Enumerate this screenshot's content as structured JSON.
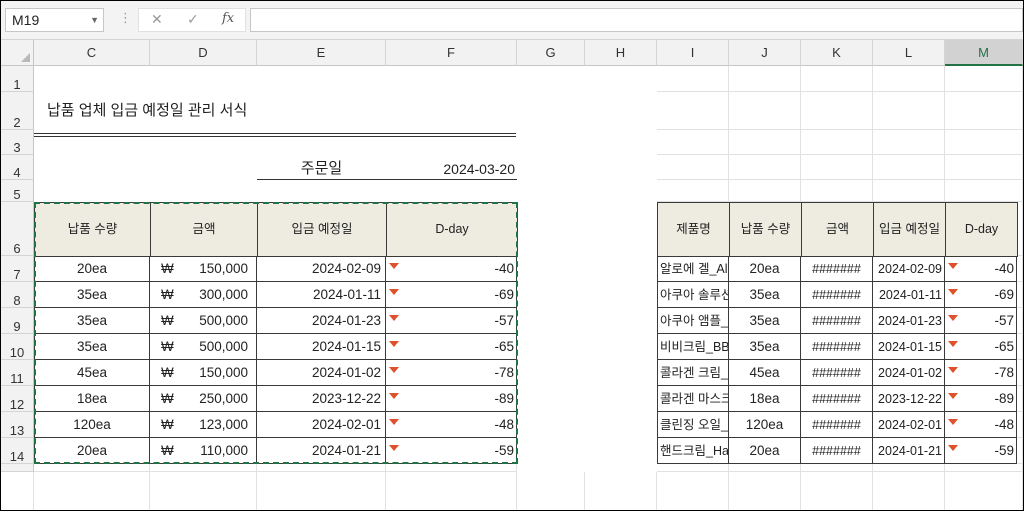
{
  "formula_bar": {
    "name_box": "M19",
    "cancel_icon": "✕",
    "enter_icon": "✓",
    "fx_label": "fx",
    "formula": ""
  },
  "columns": [
    "C",
    "D",
    "E",
    "F",
    "G",
    "H",
    "I",
    "J",
    "K",
    "L",
    "M"
  ],
  "rows": [
    "1",
    "2",
    "3",
    "4",
    "5",
    "6",
    "7",
    "8",
    "9",
    "10",
    "11",
    "12",
    "13",
    "14"
  ],
  "selected_column": "M",
  "sheet": {
    "title": "납품 업체 입금 예정일 관리 서식",
    "order_date_label": "주문일",
    "order_date_value": "2024-03-20"
  },
  "left_table": {
    "headers": [
      "납품 수량",
      "금액",
      "입금 예정일",
      "D-day"
    ],
    "currency_symbol": "₩",
    "rows": [
      {
        "qty": "20ea",
        "amount": "150,000",
        "date": "2024-02-09",
        "dday": "-40"
      },
      {
        "qty": "35ea",
        "amount": "300,000",
        "date": "2024-01-11",
        "dday": "-69"
      },
      {
        "qty": "35ea",
        "amount": "500,000",
        "date": "2024-01-23",
        "dday": "-57"
      },
      {
        "qty": "35ea",
        "amount": "500,000",
        "date": "2024-01-15",
        "dday": "-65"
      },
      {
        "qty": "45ea",
        "amount": "150,000",
        "date": "2024-01-02",
        "dday": "-78"
      },
      {
        "qty": "18ea",
        "amount": "250,000",
        "date": "2023-12-22",
        "dday": "-89"
      },
      {
        "qty": "120ea",
        "amount": "123,000",
        "date": "2024-02-01",
        "dday": "-48"
      },
      {
        "qty": "20ea",
        "amount": "110,000",
        "date": "2024-01-21",
        "dday": "-59"
      }
    ]
  },
  "right_table": {
    "headers": [
      "제품명",
      "납품 수량",
      "금액",
      "입금 예정일",
      "D-day"
    ],
    "rows": [
      {
        "product": "알로에 겔_Alo",
        "qty": "20ea",
        "amount": "#######",
        "date": "2024-02-09",
        "dday": "-40"
      },
      {
        "product": "아쿠아 솔루션",
        "qty": "35ea",
        "amount": "#######",
        "date": "2024-01-11",
        "dday": "-69"
      },
      {
        "product": "아쿠아 앰플_A",
        "qty": "35ea",
        "amount": "#######",
        "date": "2024-01-23",
        "dday": "-57"
      },
      {
        "product": "비비크림_BB",
        "qty": "35ea",
        "amount": "#######",
        "date": "2024-01-15",
        "dday": "-65"
      },
      {
        "product": "콜라겐 크림_C",
        "qty": "45ea",
        "amount": "#######",
        "date": "2024-01-02",
        "dday": "-78"
      },
      {
        "product": "콜라겐 마스크",
        "qty": "18ea",
        "amount": "#######",
        "date": "2023-12-22",
        "dday": "-89"
      },
      {
        "product": "클린징 오일_C",
        "qty": "120ea",
        "amount": "#######",
        "date": "2024-02-01",
        "dday": "-48"
      },
      {
        "product": "핸드크림_Har",
        "qty": "20ea",
        "amount": "#######",
        "date": "2024-01-21",
        "dday": "-59"
      }
    ]
  },
  "colors": {
    "header_fill": "#eeece1",
    "down_arrow": "#e0502a",
    "selection": "#217346"
  }
}
